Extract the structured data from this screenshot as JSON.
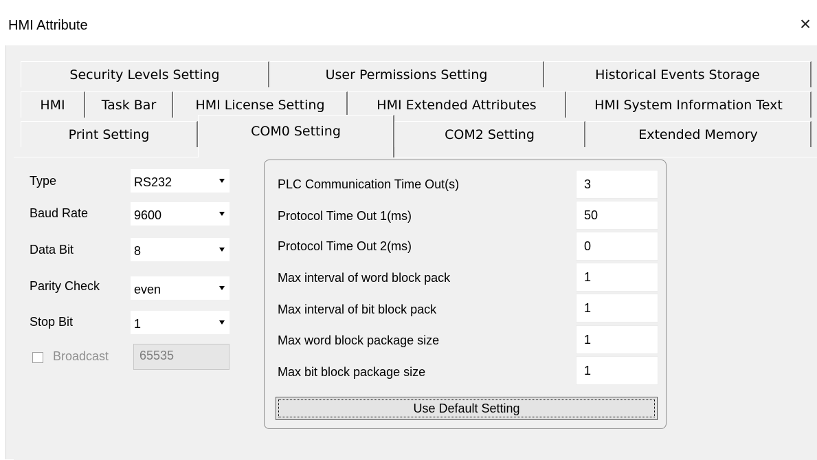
{
  "window": {
    "title": "HMI Attribute",
    "close_glyph": "×"
  },
  "tabs": {
    "row1": [
      "Security Levels Setting",
      "User Permissions Setting",
      "Historical Events Storage"
    ],
    "row2": [
      "HMI",
      "Task Bar",
      "HMI License Setting",
      "HMI Extended Attributes",
      "HMI System Information Text"
    ],
    "row3": [
      "Print Setting",
      "COM0 Setting",
      "COM2 Setting",
      "Extended Memory"
    ],
    "active": "COM0 Setting"
  },
  "com": {
    "type": {
      "label": "Type",
      "value": "RS232"
    },
    "baud_rate": {
      "label": "Baud Rate",
      "value": "9600"
    },
    "data_bit": {
      "label": "Data Bit",
      "value": "8"
    },
    "parity_check": {
      "label": "Parity Check",
      "value": "even"
    },
    "stop_bit": {
      "label": "Stop Bit",
      "value": "1"
    },
    "broadcast": {
      "label": "Broadcast",
      "checked": false,
      "enabled": false,
      "value": "65535"
    }
  },
  "protocol": {
    "rows": [
      {
        "label": "PLC Communication Time Out(s)",
        "value": "3"
      },
      {
        "label": "Protocol Time Out 1(ms)",
        "value": "50"
      },
      {
        "label": "Protocol Time Out 2(ms)",
        "value": "0"
      },
      {
        "label": "Max interval of word block pack",
        "value": "1"
      },
      {
        "label": "Max interval of bit block pack",
        "value": "1"
      },
      {
        "label": "Max word block package size",
        "value": "1"
      },
      {
        "label": "Max bit block package size",
        "value": "1"
      }
    ],
    "default_button": "Use Default Setting"
  }
}
